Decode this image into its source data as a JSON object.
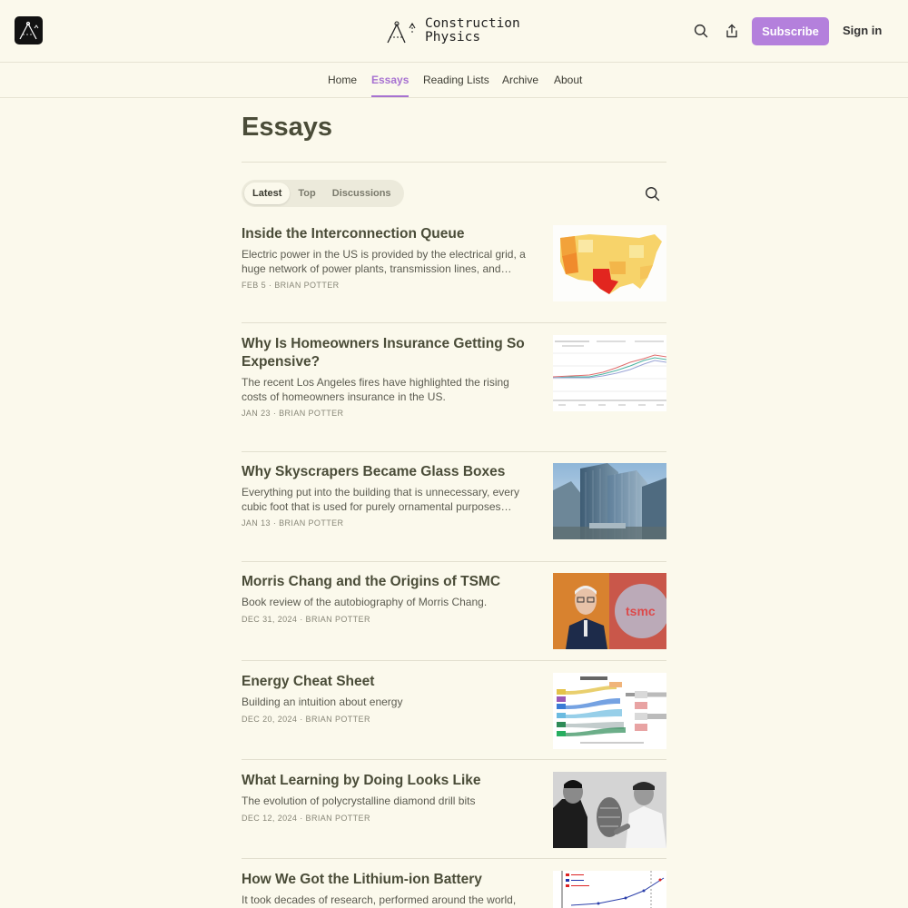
{
  "header": {
    "brand_line1": "Construction",
    "brand_line2": "Physics",
    "subscribe_label": "Subscribe",
    "signin_label": "Sign in"
  },
  "nav": {
    "items": [
      {
        "label": "Home"
      },
      {
        "label": "Essays"
      },
      {
        "label": "Reading Lists"
      },
      {
        "label": "Archive"
      },
      {
        "label": "About"
      }
    ],
    "active": "Essays"
  },
  "page": {
    "title": "Essays",
    "tabs": [
      {
        "label": "Latest"
      },
      {
        "label": "Top"
      },
      {
        "label": "Discussions"
      }
    ],
    "active_tab": "Latest"
  },
  "colors": {
    "background": "#fbf9ec",
    "accent": "#b480dc",
    "title_text": "#4a4c38"
  },
  "posts": [
    {
      "title": "Inside the Interconnection Queue",
      "subtitle": "Electric power in the US is provided by the electrical grid, a huge network of power plants, transmission lines, and…",
      "date": "FEB 5",
      "author": "BRIAN POTTER"
    },
    {
      "title": "Why Is Homeowners Insurance Getting So Expensive?",
      "subtitle": "The recent Los Angeles fires have highlighted the rising costs of homeowners insurance in the US.",
      "date": "JAN 23",
      "author": "BRIAN POTTER"
    },
    {
      "title": "Why Skyscrapers Became Glass Boxes",
      "subtitle": "Everything put into the building that is unnecessary, every cubic foot that is used for purely ornamental purposes…",
      "date": "JAN 13",
      "author": "BRIAN POTTER"
    },
    {
      "title": "Morris Chang and the Origins of TSMC",
      "subtitle": "Book review of the autobiography of Morris Chang.",
      "date": "DEC 31, 2024",
      "author": "BRIAN POTTER"
    },
    {
      "title": "Energy Cheat Sheet",
      "subtitle": "Building an intuition about energy",
      "date": "DEC 20, 2024",
      "author": "BRIAN POTTER"
    },
    {
      "title": "What Learning by Doing Looks Like",
      "subtitle": "The evolution of polycrystalline diamond drill bits",
      "date": "DEC 12, 2024",
      "author": "BRIAN POTTER"
    },
    {
      "title": "How We Got the Lithium-ion Battery",
      "subtitle": "It took decades of research, performed around the world,",
      "date": "",
      "author": ""
    }
  ],
  "icons": {
    "search": "search-icon",
    "share": "share-icon",
    "logo": "logo-icon"
  }
}
